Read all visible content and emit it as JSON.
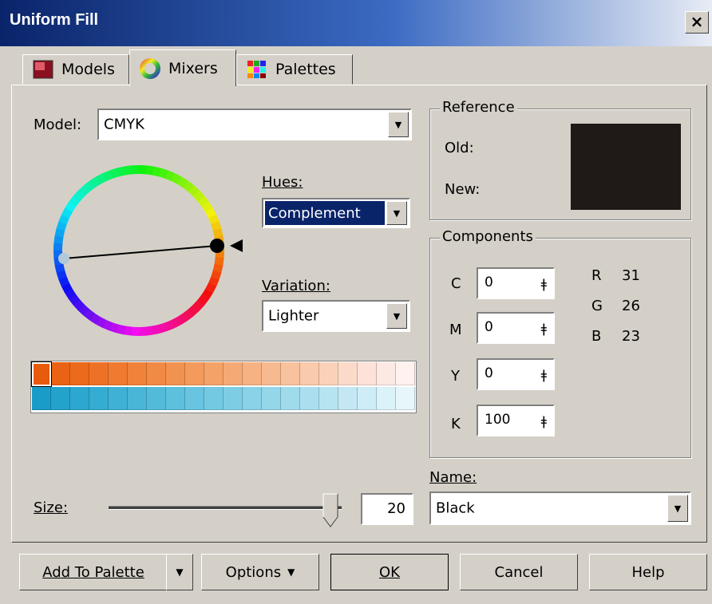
{
  "window": {
    "title": "Uniform Fill",
    "close_glyph": "×"
  },
  "tabs": [
    {
      "label": "Models",
      "icon": "models-icon",
      "active": false
    },
    {
      "label": "Mixers",
      "icon": "mixers-icon",
      "active": true
    },
    {
      "label": "Palettes",
      "icon": "palettes-icon",
      "active": false
    }
  ],
  "model": {
    "label": "Model:",
    "value": "CMYK"
  },
  "hues": {
    "label": "Hues:",
    "value": "Complement"
  },
  "variation": {
    "label": "Variation:",
    "value": "Lighter"
  },
  "reference": {
    "legend": "Reference",
    "old_label": "Old:",
    "new_label": "New:",
    "old_color": "#1f1a17",
    "new_color": "#1f1a17"
  },
  "components": {
    "legend": "Components",
    "cmyk": [
      {
        "label": "C",
        "value": "0"
      },
      {
        "label": "M",
        "value": "0"
      },
      {
        "label": "Y",
        "value": "0"
      },
      {
        "label": "K",
        "value": "100"
      }
    ],
    "rgb": [
      {
        "label": "R",
        "value": "31"
      },
      {
        "label": "G",
        "value": "26"
      },
      {
        "label": "B",
        "value": "23"
      }
    ],
    "spin_glyph": "ǂ"
  },
  "name": {
    "label": "Name:",
    "value": "Black"
  },
  "size": {
    "label": "Size:",
    "value": "20",
    "slider_fraction": 0.98
  },
  "swatches": {
    "row1": [
      "#e85a0c",
      "#ea6213",
      "#ec6a1c",
      "#ee7226",
      "#ef7a30",
      "#f0823a",
      "#f18a45",
      "#f29250",
      "#f39a5c",
      "#f4a268",
      "#f5aa75",
      "#f6b282",
      "#f7ba90",
      "#f8c29e",
      "#f9caac",
      "#fad2ba",
      "#fbdac9",
      "#fce2d8",
      "#fde9e4",
      "#fef1ee"
    ],
    "row2": [
      "#1a9cc8",
      "#23a2cc",
      "#2ca7cf",
      "#35acd2",
      "#3fb1d5",
      "#49b6d8",
      "#53bbda",
      "#5dc0dd",
      "#68c4e0",
      "#73c9e2",
      "#7ecde5",
      "#89d2e7",
      "#94d6ea",
      "#a0dbec",
      "#abdfef",
      "#b7e4f1",
      "#c3e8f4",
      "#cfedf6",
      "#dbf2f9",
      "#e7f6fb"
    ]
  },
  "buttons": {
    "add_to_palette": "Add To Palette",
    "options": "Options",
    "ok": "OK",
    "cancel": "Cancel",
    "help": "Help",
    "dropdown_glyph": "▼"
  }
}
